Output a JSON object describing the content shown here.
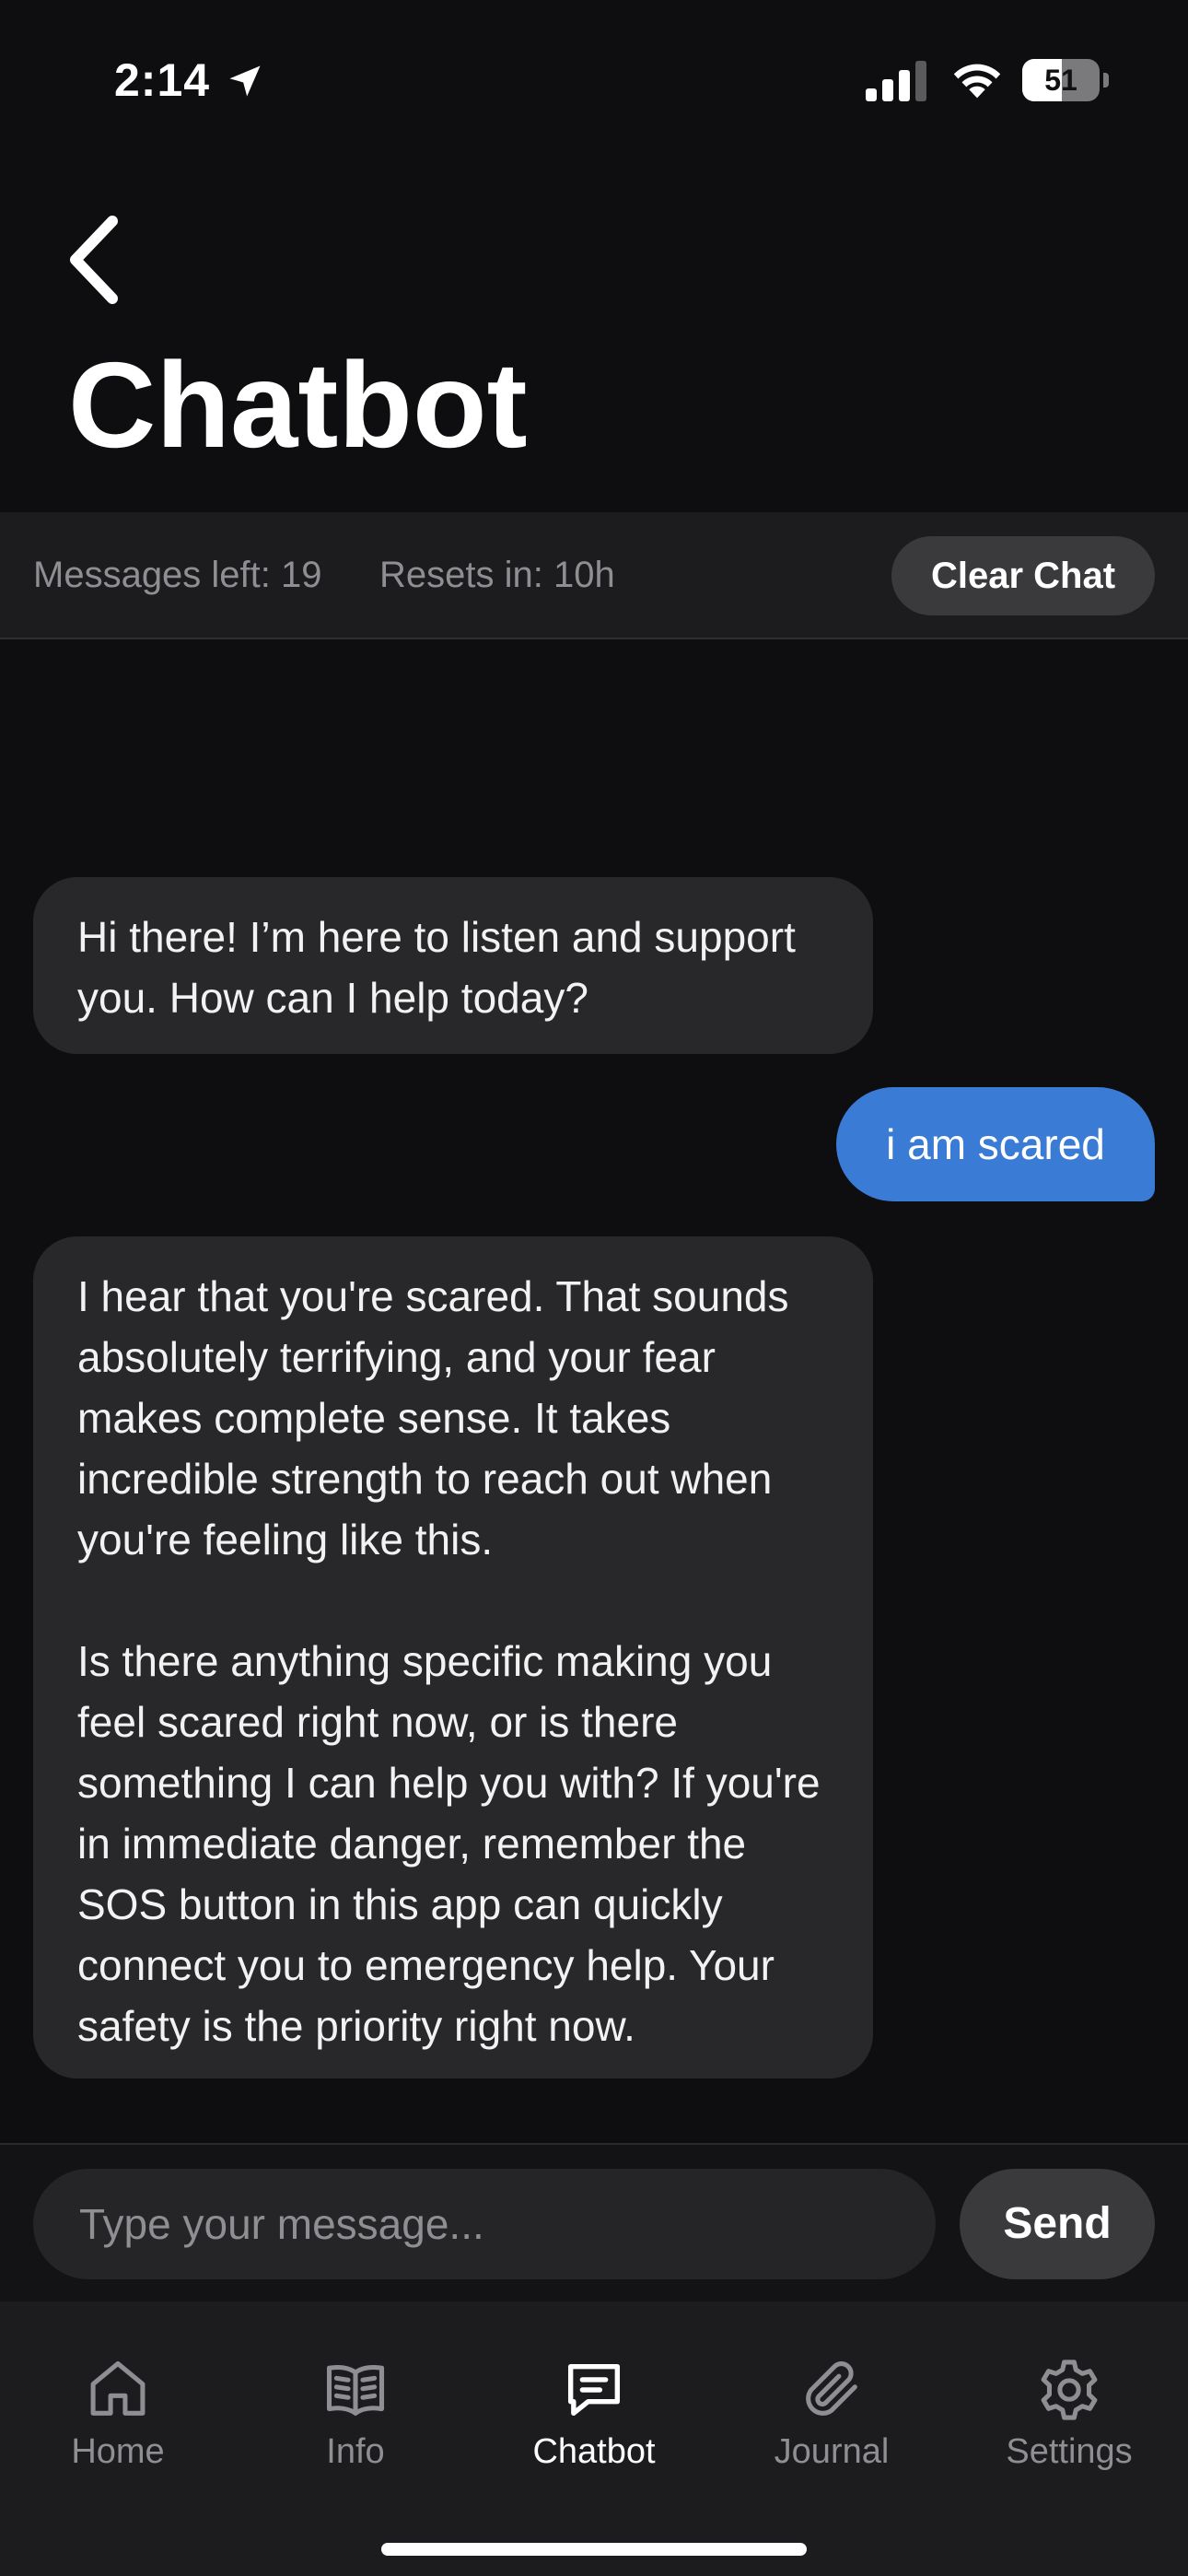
{
  "status_bar": {
    "time": "2:14",
    "battery_level": "51",
    "battery_fraction": 0.51,
    "icons": [
      "location-arrow-icon",
      "cellular-signal-icon",
      "wifi-icon",
      "battery-icon"
    ]
  },
  "header": {
    "back_icon": "chevron-left-icon",
    "title": "Chatbot"
  },
  "info_bar": {
    "messages_left": "Messages left: 19",
    "resets_in": "Resets in: 10h",
    "clear_chat_label": "Clear Chat"
  },
  "messages": [
    {
      "sender": "bot",
      "text": "Hi there! I’m here to listen and support you. How can I help today?"
    },
    {
      "sender": "user",
      "text": "i am scared"
    },
    {
      "sender": "bot",
      "text": "I hear that you're scared. That sounds absolutely terrifying, and your fear makes complete sense. It takes incredible strength to reach out when you're feeling like this.\n\nIs there anything specific making you feel scared right now, or is there something I can help you with? If you're in immediate danger, remember the SOS button in this app can quickly connect you to emergency help. Your safety is the priority right now."
    }
  ],
  "composer": {
    "placeholder": "Type your message...",
    "value": "",
    "send_label": "Send"
  },
  "tabs": [
    {
      "label": "Home",
      "icon": "home-icon",
      "active": false
    },
    {
      "label": "Info",
      "icon": "book-icon",
      "active": false
    },
    {
      "label": "Chatbot",
      "icon": "chat-bubble-icon",
      "active": true
    },
    {
      "label": "Journal",
      "icon": "paperclip-icon",
      "active": false
    },
    {
      "label": "Settings",
      "icon": "gear-icon",
      "active": false
    }
  ],
  "colors": {
    "background": "#0e0e10",
    "user_bubble": "#3a7bd5",
    "bot_bubble": "#28282a",
    "muted_text": "#8e8e93"
  }
}
